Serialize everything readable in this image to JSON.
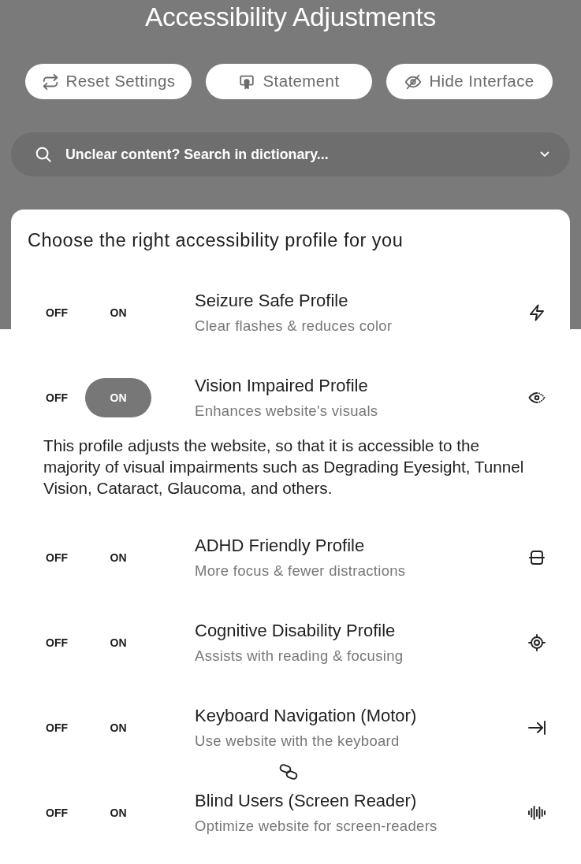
{
  "window": {
    "title": "Accessibility Adjustments"
  },
  "actions": [
    {
      "label": "Reset Settings"
    },
    {
      "label": "Statement"
    },
    {
      "label": "Hide Interface"
    }
  ],
  "search": {
    "placeholder": "Unclear content? Search in dictionary..."
  },
  "profiles_panel": {
    "heading": "Choose the right accessibility profile for you",
    "profiles": [
      {
        "off_label": "OFF",
        "on_label": "ON",
        "on": false,
        "title": "Seizure Safe Profile",
        "subtitle": "Clear flashes & reduces color"
      },
      {
        "off_label": "OFF",
        "on_label": "ON",
        "on": true,
        "title": "Vision Impaired Profile",
        "subtitle": "Enhances website's visuals",
        "description": "This profile adjusts the website, so that it is accessible to the majority of visual impairments such as Degrading Eyesight, Tunnel Vision, Cataract, Glaucoma, and others."
      },
      {
        "off_label": "OFF",
        "on_label": "ON",
        "on": false,
        "title": "ADHD Friendly Profile",
        "subtitle": "More focus & fewer distractions"
      },
      {
        "off_label": "OFF",
        "on_label": "ON",
        "on": false,
        "title": "Cognitive Disability Profile",
        "subtitle": "Assists with reading & focusing"
      },
      {
        "off_label": "OFF",
        "on_label": "ON",
        "on": false,
        "title": "Keyboard Navigation (Motor)",
        "subtitle": "Use website with the keyboard"
      },
      {
        "off_label": "OFF",
        "on_label": "ON",
        "on": false,
        "title": "Blind Users (Screen Reader)",
        "subtitle": "Optimize website for screen-readers"
      }
    ]
  }
}
